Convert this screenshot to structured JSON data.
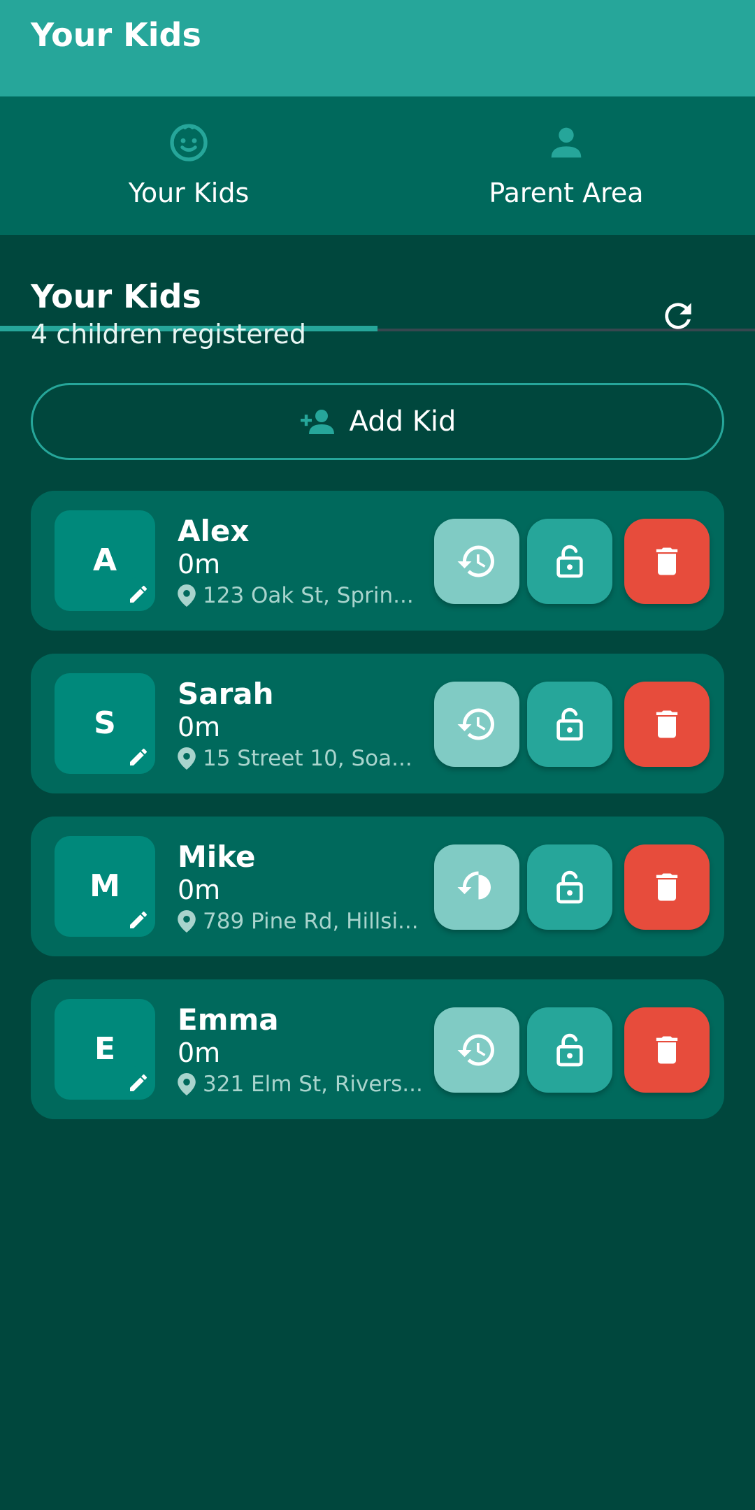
{
  "appbar": {
    "title": "Your Kids"
  },
  "tabs": [
    {
      "label": "Your Kids",
      "icon": "baby-face-icon",
      "selected": true
    },
    {
      "label": "Parent Area",
      "icon": "person-icon",
      "selected": false
    }
  ],
  "section": {
    "title": "Your Kids",
    "subtitle": "4 children registered",
    "refresh_icon": "refresh-icon"
  },
  "add_kid": {
    "label": "Add Kid",
    "icon": "person-add-icon"
  },
  "kids": [
    {
      "initial": "A",
      "name": "Alex",
      "distance": "0m",
      "address": "123 Oak St, Sprin..."
    },
    {
      "initial": "S",
      "name": "Sarah",
      "distance": "0m",
      "address": "15 Street 10, Soa..."
    },
    {
      "initial": "M",
      "name": "Mike",
      "distance": "0m",
      "address": "789 Pine Rd, Hillsi..."
    },
    {
      "initial": "E",
      "name": "Emma",
      "distance": "0m",
      "address": "321 Elm St, Rivers..."
    }
  ],
  "colors": {
    "background": "#00473d",
    "appbar": "#26a69a",
    "tabbar": "#00695c",
    "card": "#00695c",
    "avatar": "#00897b",
    "history_button": "#80cbc4",
    "lock_button": "#26a69a",
    "delete_button": "#e74c3c"
  }
}
